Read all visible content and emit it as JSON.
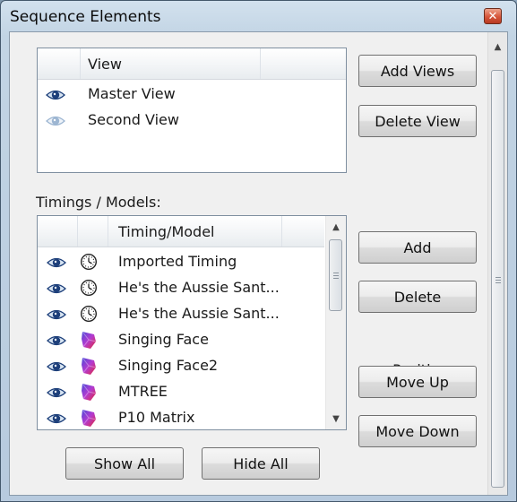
{
  "window": {
    "title": "Sequence Elements",
    "close_icon": "close-icon"
  },
  "views": {
    "column_header": "View",
    "rows": [
      {
        "name": "Master View",
        "visible": true,
        "icon": "eye-icon"
      },
      {
        "name": "Second View",
        "visible": false,
        "icon": "eye-icon"
      }
    ],
    "add_views_label": "Add Views",
    "delete_view_label": "Delete View"
  },
  "timings": {
    "section_label": "Timings / Models:",
    "column_header": "Timing/Model",
    "rows": [
      {
        "name": "Imported Timing",
        "icon": "clock-icon"
      },
      {
        "name": "He's the Aussie Sant...",
        "icon": "clock-icon"
      },
      {
        "name": "He's the Aussie Sant...",
        "icon": "clock-icon"
      },
      {
        "name": "Singing Face",
        "icon": "face-model-icon"
      },
      {
        "name": "Singing Face2",
        "icon": "face-model-icon"
      },
      {
        "name": "MTREE",
        "icon": "face-model-icon"
      },
      {
        "name": "P10 Matrix",
        "icon": "face-model-icon"
      }
    ],
    "add_label": "Add",
    "delete_label": "Delete",
    "position_label": "Position:",
    "move_up_label": "Move Up",
    "move_down_label": "Move Down",
    "show_all_label": "Show All",
    "hide_all_label": "Hide All"
  },
  "colors": {
    "eye_visible": "#1d3f7a",
    "eye_hidden": "#9db6d2",
    "close_button": "#d6553a"
  }
}
